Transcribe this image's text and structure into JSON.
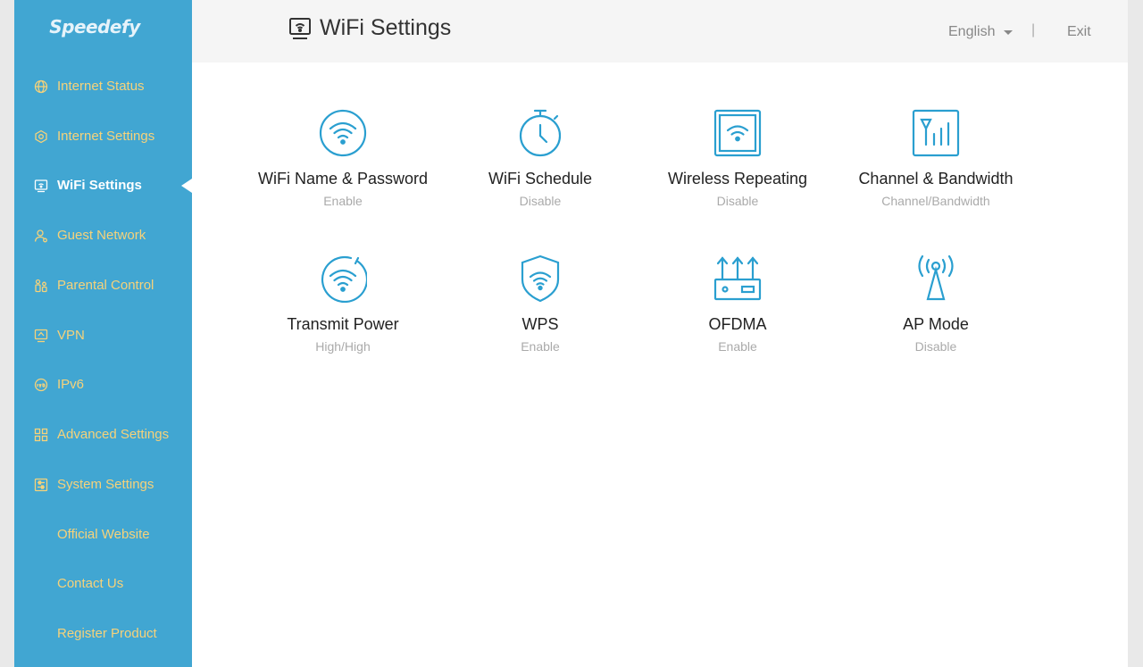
{
  "brand": {
    "name": "Speedefy"
  },
  "header": {
    "title": "WiFi Settings",
    "title_icon": "wifi-monitor-icon",
    "language": "English",
    "separator": "|",
    "exit_label": "Exit"
  },
  "sidebar": {
    "items": [
      {
        "label": "Internet Status",
        "icon": "globe-icon"
      },
      {
        "label": "Internet Settings",
        "icon": "hexagon-gear-icon"
      },
      {
        "label": "WiFi Settings",
        "icon": "wifi-monitor-icon",
        "active": true
      },
      {
        "label": "Guest Network",
        "icon": "guest-user-icon"
      },
      {
        "label": "Parental Control",
        "icon": "parental-family-icon"
      },
      {
        "label": "VPN",
        "icon": "vpn-monitor-icon"
      },
      {
        "label": "IPv6",
        "icon": "ipv6-circle-icon"
      },
      {
        "label": "Advanced Settings",
        "icon": "grid-icon"
      },
      {
        "label": "System Settings",
        "icon": "system-sliders-icon"
      },
      {
        "label": "Official Website"
      },
      {
        "label": "Contact Us"
      },
      {
        "label": "Register Product"
      }
    ]
  },
  "tiles": [
    {
      "name": "WiFi Name & Password",
      "status": "Enable",
      "icon": "wifi-circle-icon"
    },
    {
      "name": "WiFi Schedule",
      "status": "Disable",
      "icon": "stopwatch-icon"
    },
    {
      "name": "Wireless Repeating",
      "status": "Disable",
      "icon": "wifi-square-icon"
    },
    {
      "name": "Channel & Bandwidth",
      "status": "Channel/Bandwidth",
      "icon": "signal-bars-icon"
    },
    {
      "name": "Transmit Power",
      "status": "High/High",
      "icon": "wifi-power-icon"
    },
    {
      "name": "WPS",
      "status": "Enable",
      "icon": "wifi-shield-icon"
    },
    {
      "name": "OFDMA",
      "status": "Enable",
      "icon": "router-antennas-icon"
    },
    {
      "name": "AP Mode",
      "status": "Disable",
      "icon": "antenna-tower-icon"
    }
  ],
  "colors": {
    "sidebar_bg": "#41a6d2",
    "sidebar_text": "#f6d27a",
    "icon_blue": "#2a9fd0",
    "status_gray": "#aaaaaa"
  }
}
